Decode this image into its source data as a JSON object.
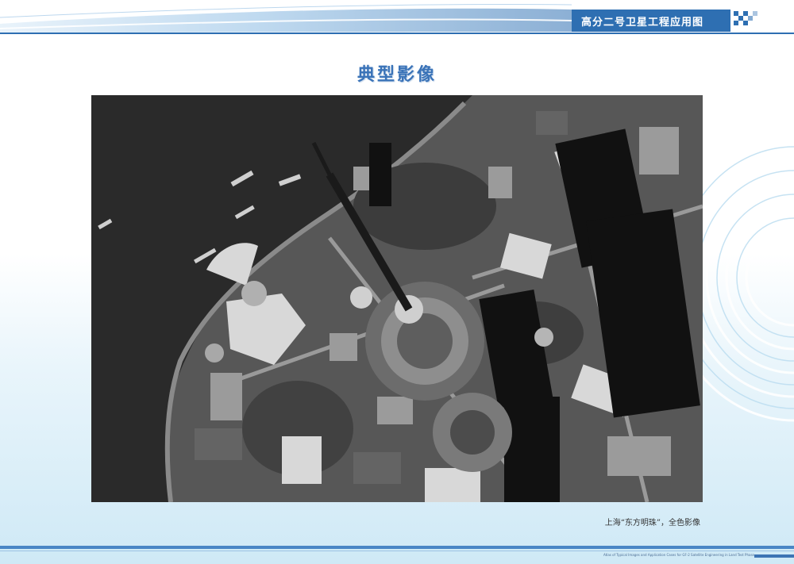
{
  "header": {
    "title": "高分二号卫星工程应用图",
    "accent_color": "#2e6fb2"
  },
  "page": {
    "title": "典型影像"
  },
  "figure": {
    "caption": "上海“东方明珠”，全色影像",
    "image_type": "grayscale-satellite-photo"
  },
  "footer": {
    "small_text_line1": "Atlas of Typical Images and Application Cases for GF-2 Satellite Engineering in Land Test Phase"
  }
}
